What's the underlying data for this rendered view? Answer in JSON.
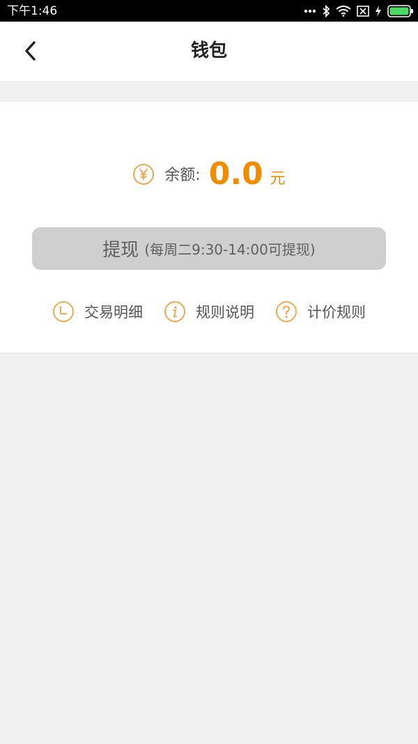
{
  "status_bar": {
    "time": "下午1:46"
  },
  "header": {
    "title": "钱包"
  },
  "wallet": {
    "balance_label": "余额:",
    "balance_value": "0.0",
    "balance_unit": "元",
    "withdraw_label": "提现",
    "withdraw_hint": "(每周二9:30-14:00可提现)"
  },
  "links": [
    {
      "label": "交易明细",
      "icon": "clock-icon"
    },
    {
      "label": "规则说明",
      "icon": "info-icon"
    },
    {
      "label": "计价规则",
      "icon": "question-icon"
    }
  ],
  "colors": {
    "accent": "#f08c00",
    "button_disabled": "#cfcfcf",
    "background": "#f1f1f1"
  }
}
